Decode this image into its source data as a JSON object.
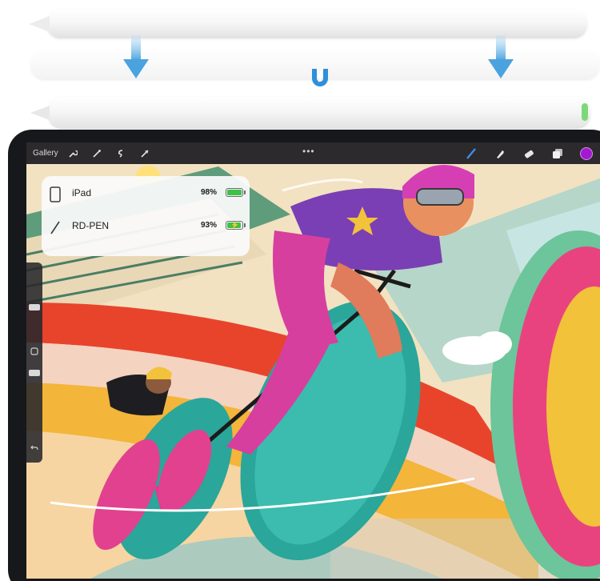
{
  "toolbar": {
    "gallery_label": "Gallery",
    "menu_dots": "•••",
    "icons": [
      "wrench-icon",
      "magic-wand-icon",
      "selection-icon",
      "transform-arrow-icon"
    ],
    "right_icons": [
      "brush-icon",
      "smudge-icon",
      "eraser-icon",
      "layers-icon",
      "color-icon"
    ],
    "active_color": "#a21ad0"
  },
  "battery_popup": {
    "devices": [
      {
        "name": "iPad",
        "percent": "98%",
        "level": 0.98,
        "charging": false
      },
      {
        "name": "RD-PEN",
        "percent": "93%",
        "level": 0.93,
        "charging": true
      }
    ],
    "battery_color": "#3fc046"
  },
  "pencil": {
    "led_color": "#7bd97a",
    "arrow_color": "#4aa3df",
    "magnet_color": "#2f8fd8"
  },
  "sidebar": {
    "icons": [
      "square-icon",
      "undo-icon"
    ]
  }
}
